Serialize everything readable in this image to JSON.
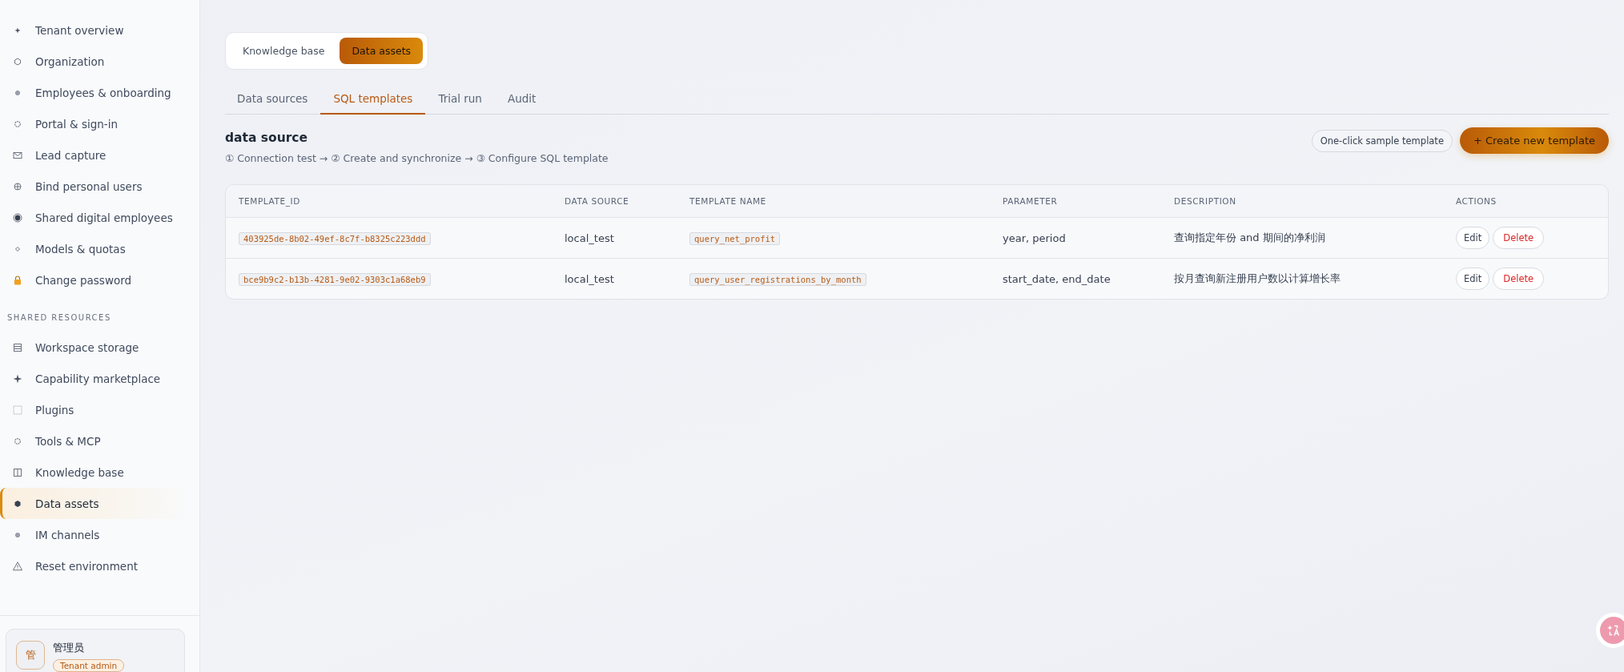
{
  "sidebar": {
    "sections": [
      {
        "items": [
          {
            "label": "Tenant overview",
            "selected": false
          },
          {
            "label": "Organization",
            "selected": false
          },
          {
            "label": "Employees & onboarding",
            "selected": false
          },
          {
            "label": "Portal & sign-in",
            "selected": false
          },
          {
            "label": "Lead capture",
            "selected": false
          },
          {
            "label": "Bind personal users",
            "selected": false
          },
          {
            "label": "Shared digital employees",
            "selected": false
          },
          {
            "label": "Models & quotas",
            "selected": false
          },
          {
            "label": "Change password",
            "selected": false
          }
        ]
      },
      {
        "title": "SHARED RESOURCES",
        "items": [
          {
            "label": "Workspace storage",
            "selected": false
          },
          {
            "label": "Capability marketplace",
            "selected": false
          },
          {
            "label": "Plugins",
            "selected": false
          },
          {
            "label": "Tools & MCP",
            "selected": false
          },
          {
            "label": "Knowledge base",
            "selected": false
          },
          {
            "label": "Data assets",
            "selected": true
          },
          {
            "label": "IM channels",
            "selected": false
          },
          {
            "label": "Reset environment",
            "selected": false
          }
        ]
      }
    ],
    "user": {
      "avatar": "管",
      "name": "管理员",
      "role": "Tenant admin"
    }
  },
  "segments": [
    {
      "label": "Knowledge base",
      "selected": false
    },
    {
      "label": "Data assets",
      "selected": true
    }
  ],
  "tabs": [
    {
      "label": "Data sources",
      "selected": false
    },
    {
      "label": "SQL templates",
      "selected": true
    },
    {
      "label": "Trial run",
      "selected": false
    },
    {
      "label": "Audit",
      "selected": false
    }
  ],
  "heading": {
    "title": "data source",
    "steps": "① Connection test → ② Create and synchronize → ③ Configure SQL template"
  },
  "buttons": {
    "sample": "One-click sample template",
    "create": "+ Create new template"
  },
  "table": {
    "columns": [
      "TEMPLATE_ID",
      "DATA SOURCE",
      "TEMPLATE NAME",
      "PARAMETER",
      "DESCRIPTION",
      "ACTIONS"
    ],
    "rows": [
      {
        "template_id": "403925de-8b02-49ef-8c7f-b8325c223ddd",
        "data_source": "local_test",
        "template_name": "query_net_profit",
        "parameter": "year, period",
        "description": "查询指定年份 and 期间的净利润",
        "actions": [
          "Edit",
          "Delete"
        ]
      },
      {
        "template_id": "bce9b9c2-b13b-4281-9e02-9303c1a68eb9",
        "data_source": "local_test",
        "template_name": "query_user_registrations_by_month",
        "parameter": "start_date, end_date",
        "description": "按月查询新注册用户数以计算增长率",
        "actions": [
          "Edit",
          "Delete"
        ]
      }
    ]
  }
}
